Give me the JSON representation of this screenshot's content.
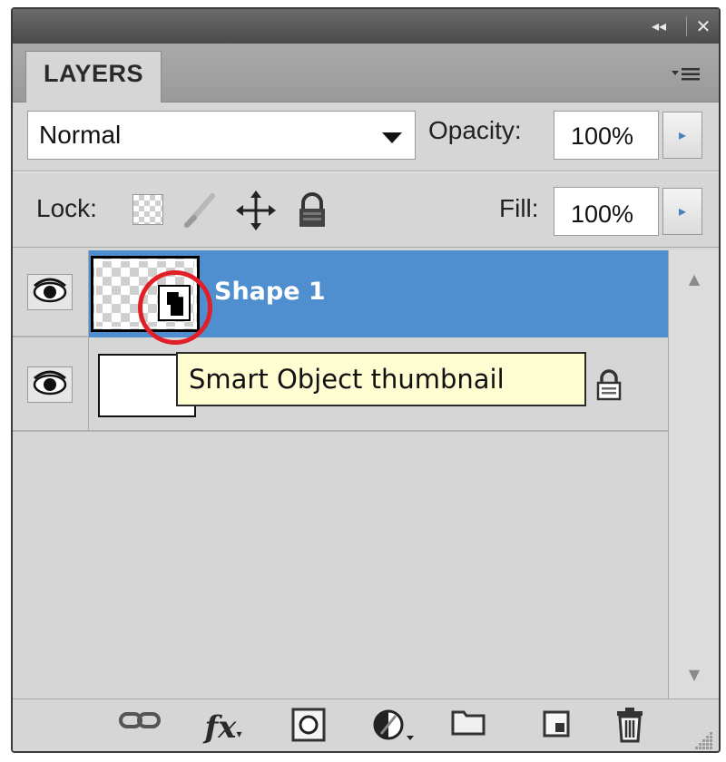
{
  "panel": {
    "title_controls": {
      "collapse": "◂◂",
      "close": "✕"
    },
    "tab": {
      "label": "LAYERS"
    },
    "menu_icon": "panel-menu-icon",
    "blend": {
      "mode": "Normal"
    },
    "opacity": {
      "label": "Opacity:",
      "value": "100%"
    },
    "lock": {
      "label": "Lock:"
    },
    "fill": {
      "label": "Fill:",
      "value": "100%"
    }
  },
  "layers": [
    {
      "name": "Shape 1",
      "selected": true,
      "smart_object": true
    },
    {
      "name": "",
      "selected": false,
      "locked": true
    }
  ],
  "tooltip": {
    "text": "Smart Object thumbnail"
  },
  "colors": {
    "selected_row": "#4f8fcf",
    "highlight": "#e21f26",
    "tooltip_bg": "#fffed2",
    "panel_bg": "#d6d6d6"
  },
  "bottom_bar": {
    "icons": [
      "link-layers-icon",
      "fx-icon",
      "layer-mask-icon",
      "adjustment-layer-icon",
      "new-group-icon",
      "new-layer-icon",
      "delete-layer-icon"
    ],
    "fx_label": "fx"
  }
}
